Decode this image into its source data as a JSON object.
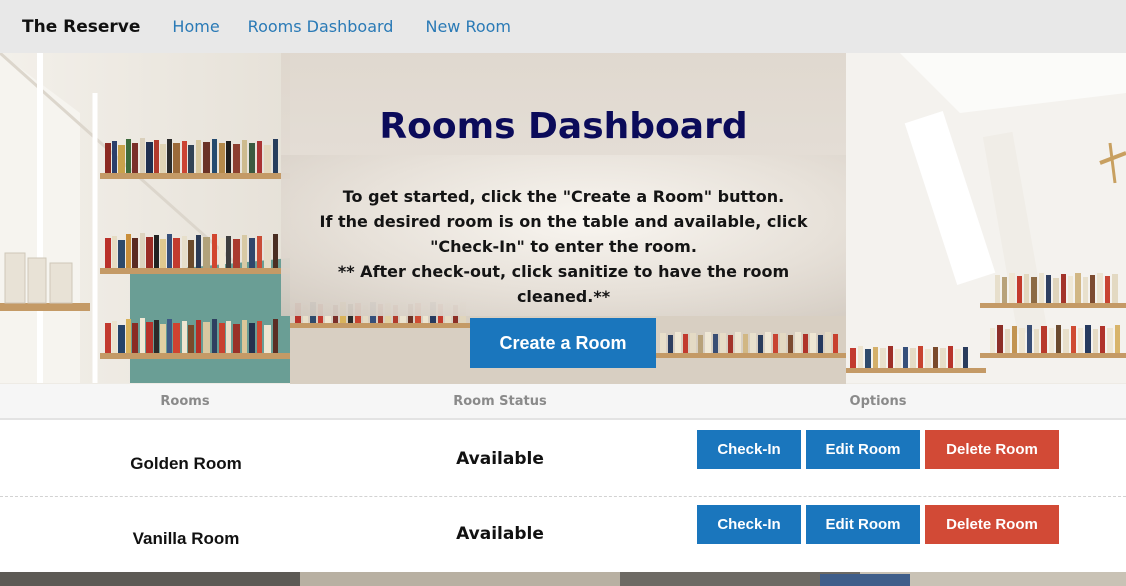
{
  "navbar": {
    "brand": "The Reserve",
    "links": [
      "Home",
      "Rooms Dashboard",
      "New Room"
    ]
  },
  "header": {
    "title": "Rooms Dashboard",
    "intro_lines": [
      "To get started, click the \"Create a Room\" button.",
      "If the desired room is on the table and available, click",
      "\"Check-In\" to enter the room.",
      "** After check-out, click sanitize to have the room",
      "cleaned.**"
    ],
    "create_button": "Create a Room"
  },
  "table": {
    "columns": [
      "Rooms",
      "Room Status",
      "Options"
    ],
    "rows": [
      {
        "name": "Golden Room",
        "status": "Available"
      },
      {
        "name": "Vanilla Room",
        "status": "Available"
      }
    ],
    "actions": {
      "checkin": "Check-In",
      "edit": "Edit Room",
      "delete": "Delete Room"
    }
  },
  "colors": {
    "primary": "#1a76bd",
    "danger": "#d24a36",
    "title": "#0b0b5a",
    "link": "#2a7ab6",
    "navbar_bg": "#e8e8e8"
  },
  "background_image": "library-bookshelves"
}
